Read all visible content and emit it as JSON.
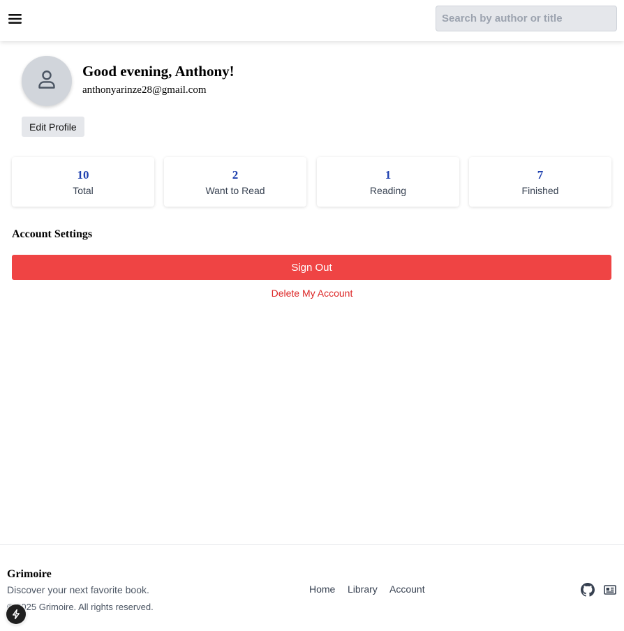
{
  "header": {
    "search_placeholder": "Search by author or title"
  },
  "profile": {
    "greeting": "Good evening, Anthony!",
    "email": "anthonyarinze28@gmail.com",
    "edit_label": "Edit Profile"
  },
  "stats": [
    {
      "value": "10",
      "label": "Total"
    },
    {
      "value": "2",
      "label": "Want to Read"
    },
    {
      "value": "1",
      "label": "Reading"
    },
    {
      "value": "7",
      "label": "Finished"
    }
  ],
  "account": {
    "title": "Account Settings",
    "signout_label": "Sign Out",
    "delete_label": "Delete My Account"
  },
  "footer": {
    "brand": "Grimoire",
    "tagline": "Discover your next favorite book.",
    "copyright": "© 2025 Grimoire. All rights reserved.",
    "nav": [
      "Home",
      "Library",
      "Account"
    ]
  },
  "colors": {
    "accent_blue": "#1e40af",
    "danger_red": "#ef4444",
    "surface_gray": "#e5e7eb"
  },
  "icons": {
    "menu": "hamburger-menu-icon",
    "avatar": "user-icon",
    "github": "github-icon",
    "news": "newspaper-icon",
    "dev": "lightning-icon"
  }
}
